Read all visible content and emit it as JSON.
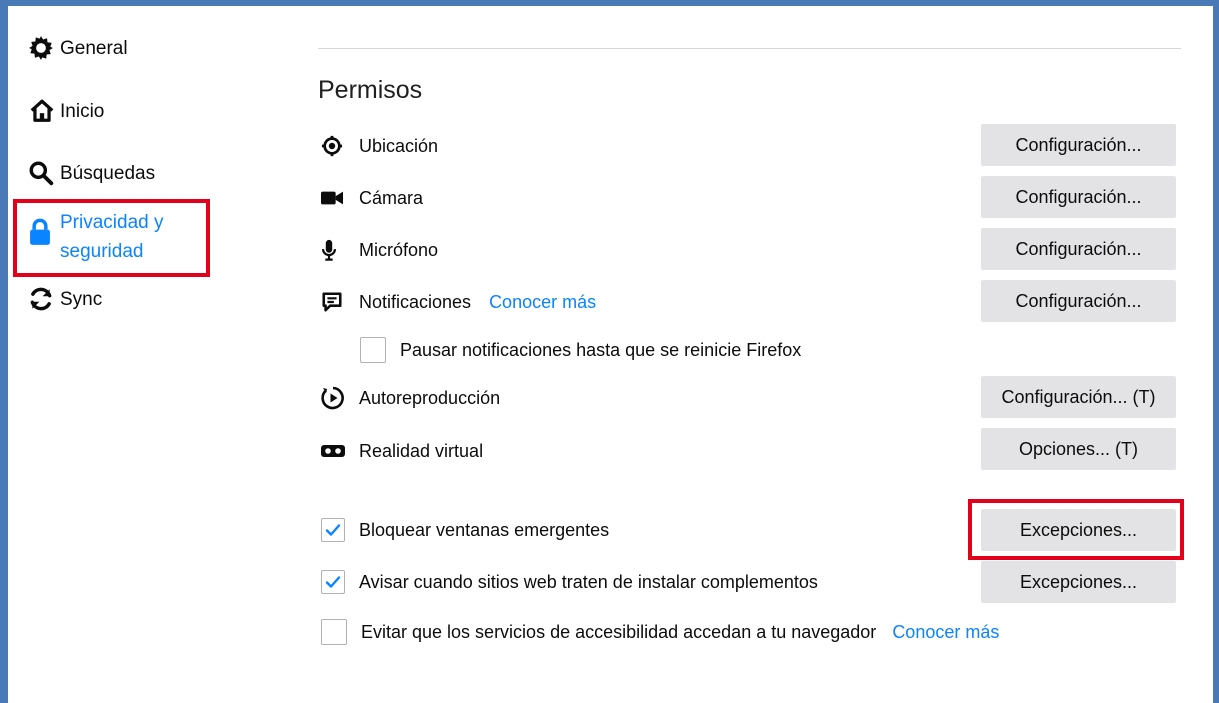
{
  "sidebar": {
    "items": [
      {
        "label": "General",
        "icon": "gear-icon"
      },
      {
        "label": "Inicio",
        "icon": "home-icon"
      },
      {
        "label": "Búsquedas",
        "icon": "search-icon"
      },
      {
        "label_line1": "Privacidad y",
        "label_line2": "seguridad",
        "icon": "lock-icon",
        "active": true
      },
      {
        "label": "Sync",
        "icon": "sync-icon"
      }
    ]
  },
  "permissions": {
    "title": "Permisos",
    "rows": [
      {
        "label": "Ubicación",
        "icon": "location-icon",
        "button": "Configuración..."
      },
      {
        "label": "Cámara",
        "icon": "camera-icon",
        "button": "Configuración..."
      },
      {
        "label": "Micrófono",
        "icon": "microphone-icon",
        "button": "Configuración..."
      },
      {
        "label": "Notificaciones",
        "icon": "notification-icon",
        "link": "Conocer más",
        "button": "Configuración..."
      },
      {
        "label": "Autoreproducción",
        "icon": "autoplay-icon",
        "button": "Configuración... (T)"
      },
      {
        "label": "Realidad virtual",
        "icon": "vr-icon",
        "button": "Opciones... (T)"
      }
    ],
    "pause_notifications": {
      "label": "Pausar notificaciones hasta que se reinicie Firefox",
      "checked": false
    },
    "block_popups": {
      "label": "Bloquear ventanas emergentes",
      "checked": true,
      "button": "Excepciones..."
    },
    "warn_addons": {
      "label": "Avisar cuando sitios web traten de instalar complementos",
      "checked": true,
      "button": "Excepciones..."
    },
    "accessibility": {
      "label": "Evitar que los servicios de accesibilidad accedan a tu navegador",
      "checked": false,
      "link": "Conocer más"
    }
  },
  "colors": {
    "accent": "#0a84ff",
    "highlight": "#e3001b",
    "frame": "#4a79b8",
    "button_bg": "#e3e3e5"
  }
}
